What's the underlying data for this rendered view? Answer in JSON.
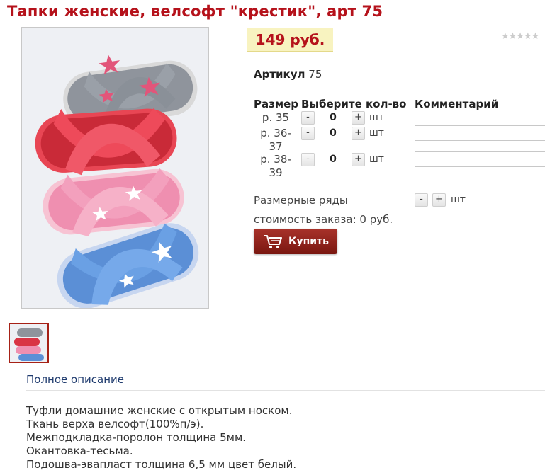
{
  "product": {
    "title": "Тапки женские, велсофт \"крестик\", арт 75",
    "price": "149 руб.",
    "rating_stars": "★★★★★",
    "sku_label": "Артикул",
    "sku_value": "75"
  },
  "size_table": {
    "headers": {
      "size": "Размер",
      "qty": "Выберите кол-во",
      "comment": "Комментарий"
    },
    "rows": [
      {
        "size": "р. 35",
        "qty": "0",
        "unit": "шт"
      },
      {
        "size": "р. 36-37",
        "qty": "0",
        "unit": "шт"
      },
      {
        "size": "р. 38-39",
        "qty": "0",
        "unit": "шт"
      }
    ],
    "minus": "-",
    "plus": "+"
  },
  "size_rows": {
    "label": "Размерные ряды",
    "unit": "шт"
  },
  "order": {
    "cost_text": "стоимость заказа: 0 руб.",
    "buy_label": "Купить"
  },
  "tabs": {
    "description": "Полное описание"
  },
  "description": [
    "Туфли домашние  женские с открытым носком.",
    "Ткань верха велсофт(100%п/э).",
    "Межподкладка-поролон толщина 5мм.",
    "Окантовка-тесьма.",
    "Подошва-эвапласт толщина 6,5 мм цвет белый."
  ],
  "colors": {
    "title": "#b5121b",
    "price_bg": "#f8f3c0",
    "buy_button": "#8e2419",
    "link": "#1f3b6e"
  },
  "icons": {
    "rating": "star-icon",
    "buy": "cart-icon"
  }
}
